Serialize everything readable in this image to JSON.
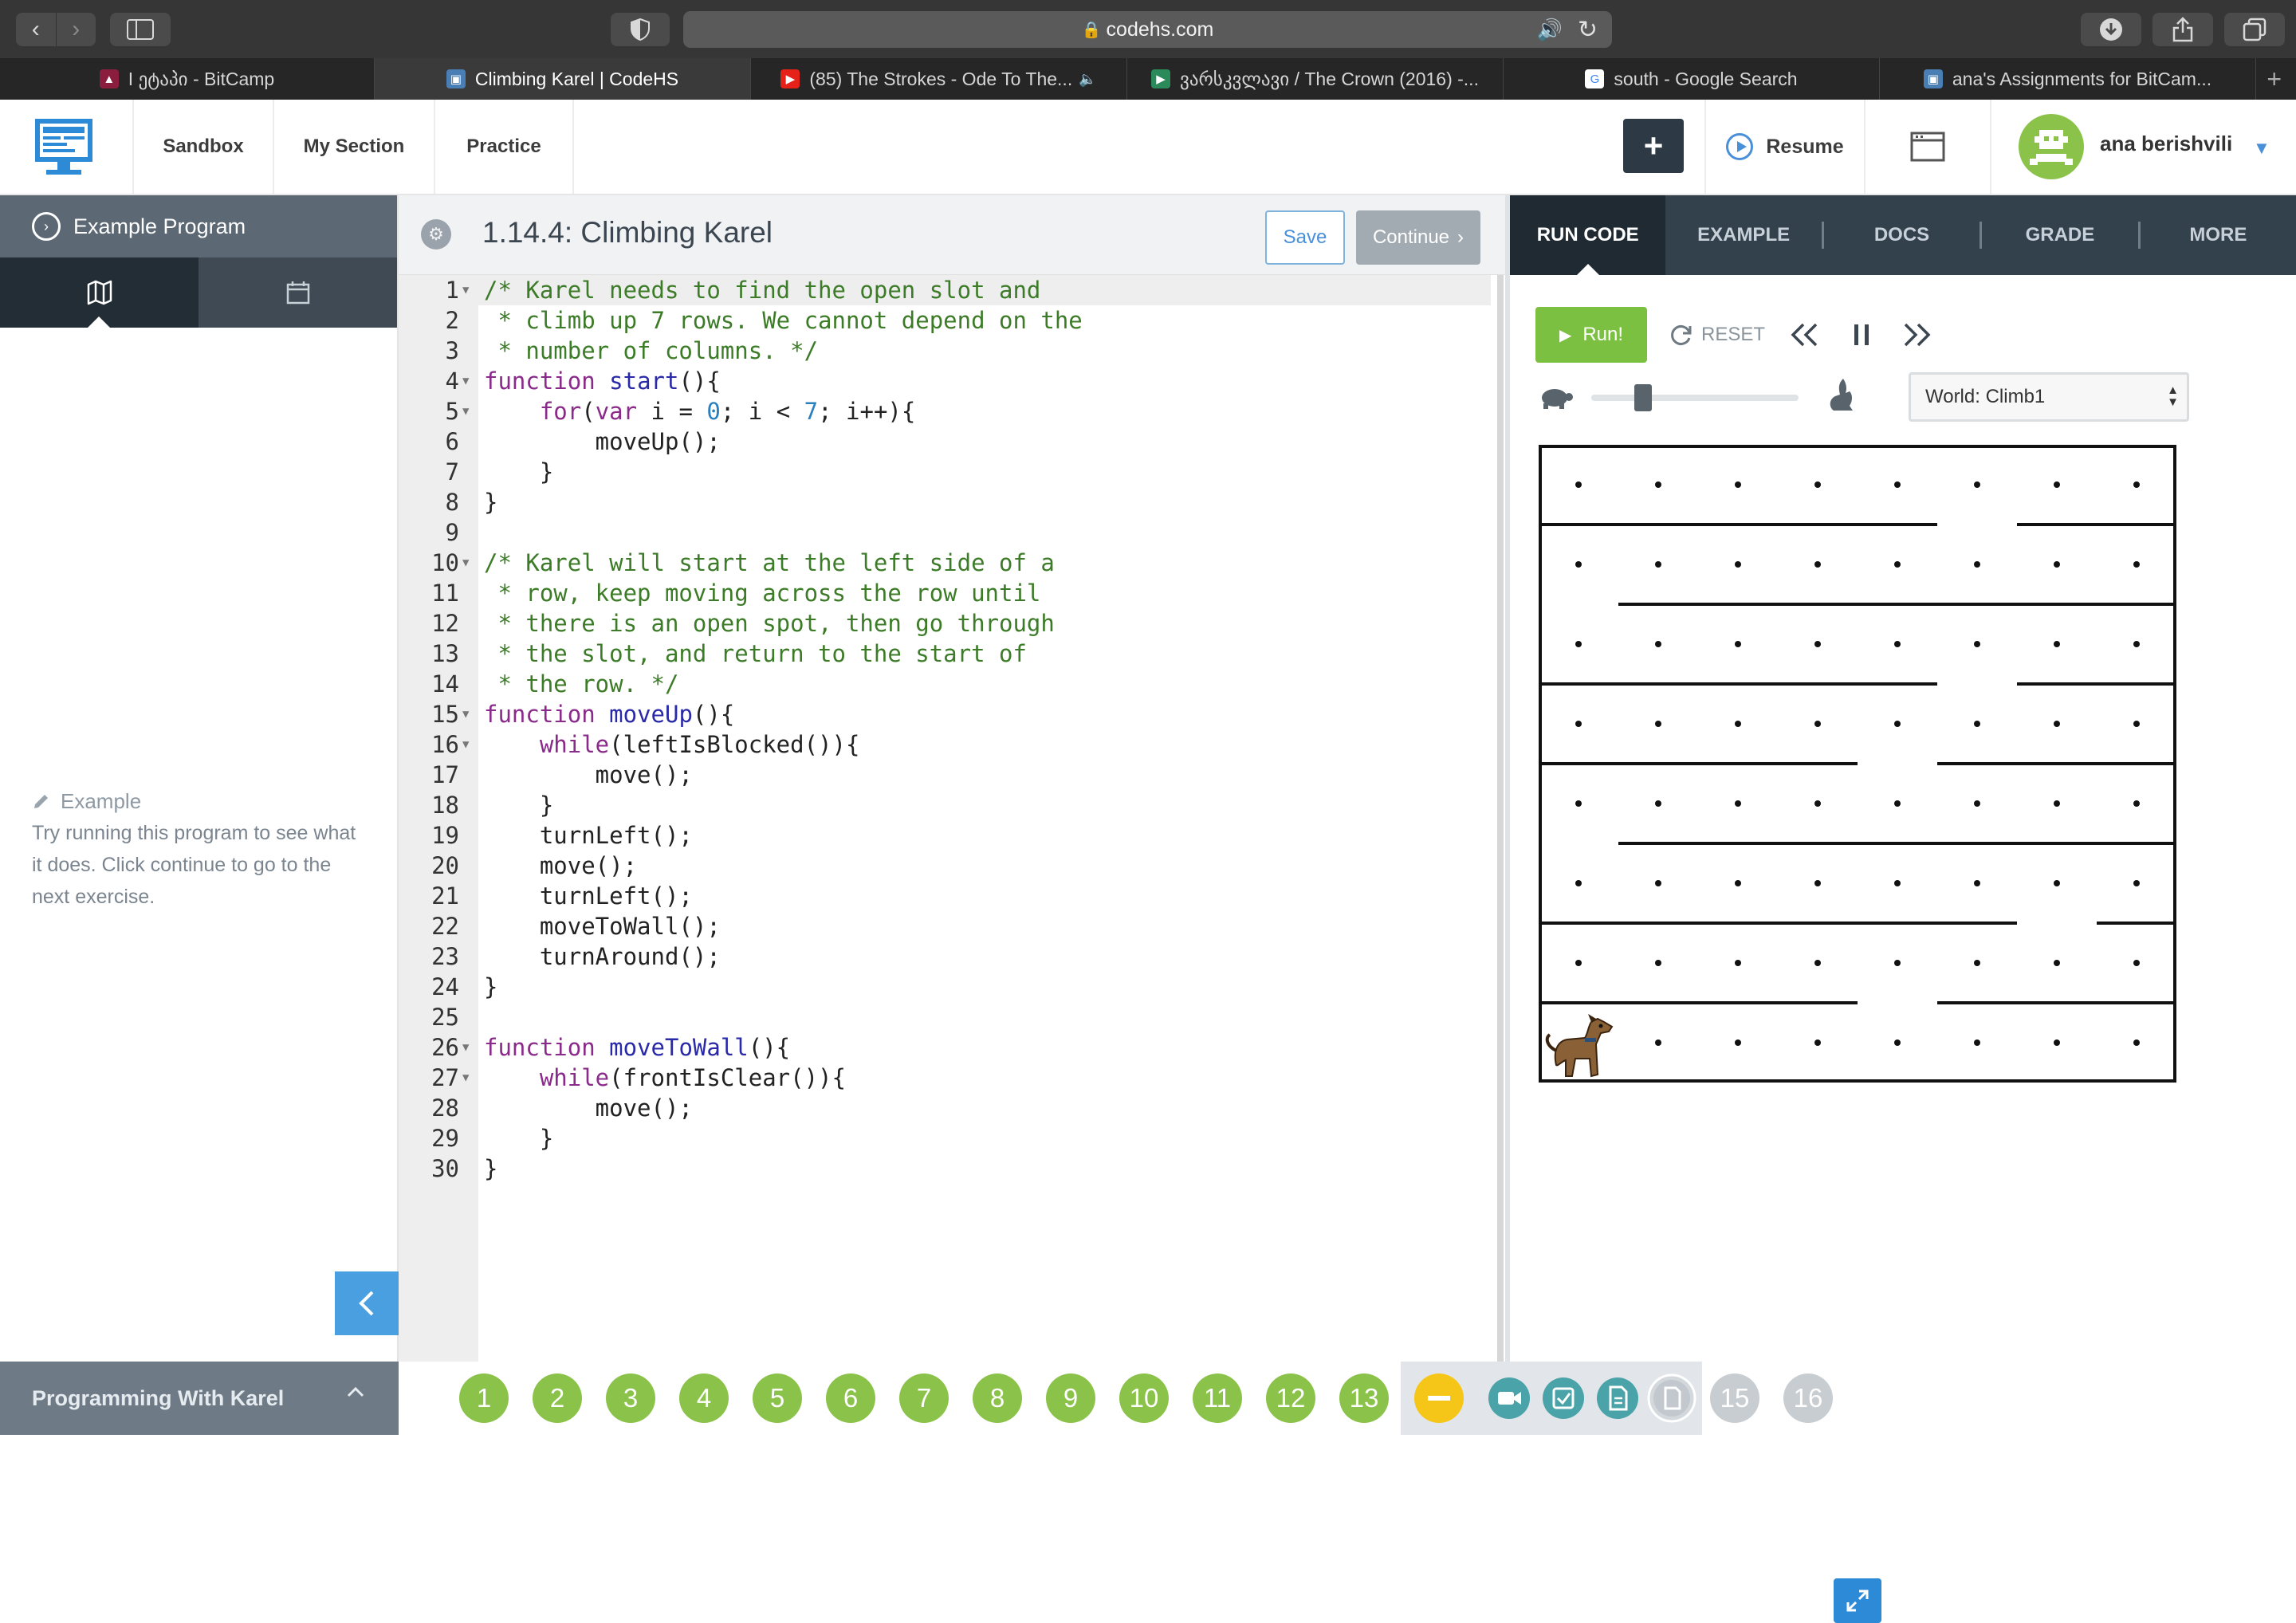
{
  "browser": {
    "url": "codehs.com",
    "tabs": [
      {
        "title": "I ეტაპი - BitCamp",
        "fav_color": "#8b1e3f",
        "fav_text": "▲"
      },
      {
        "title": "Climbing Karel | CodeHS",
        "fav_color": "#4a7fb5",
        "fav_text": "▣",
        "active": true
      },
      {
        "title": "(85) The Strokes - Ode To The...",
        "fav_color": "#e62117",
        "fav_text": "▶",
        "speaker": true
      },
      {
        "title": "ვარსკვლავი / The Crown (2016) -...",
        "fav_color": "#2a8a5a",
        "fav_text": "▶"
      },
      {
        "title": "south - Google Search",
        "fav_color": "#ffffff",
        "fav_text": "G"
      },
      {
        "title": "ana's Assignments for BitCam...",
        "fav_color": "#4a7fb5",
        "fav_text": "▣"
      }
    ]
  },
  "header": {
    "nav": [
      "Sandbox",
      "My Section",
      "Practice"
    ],
    "plus_label": "+",
    "resume_label": "Resume",
    "user_name": "ana berishvili"
  },
  "sidebar": {
    "section_title": "Example Program",
    "note_title": "Example",
    "note_text": "Try running this program to see what it does. Click continue to go to the next exercise.",
    "course_title": "Programming With Karel"
  },
  "editor": {
    "exercise_title": "1.14.4: Climbing Karel",
    "save_label": "Save",
    "continue_label": "Continue",
    "code_lines": [
      "/* Karel needs to find the open slot and",
      " * climb up 7 rows. We cannot depend on the",
      " * number of columns. */",
      "function start(){",
      "    for(var i = 0; i < 7; i++){",
      "        moveUp();",
      "    }",
      "}",
      "",
      "/* Karel will start at the left side of a",
      " * row, keep moving across the row until",
      " * there is an open spot, then go through",
      " * the slot, and return to the start of",
      " * the row. */",
      "function moveUp(){",
      "    while(leftIsBlocked()){",
      "        move();",
      "    }",
      "    turnLeft();",
      "    move();",
      "    turnLeft();",
      "    moveToWall();",
      "    turnAround();",
      "}",
      "",
      "function moveToWall(){",
      "    while(frontIsClear()){",
      "        move();",
      "    }",
      "}"
    ],
    "fold_lines": [
      1,
      4,
      5,
      10,
      15,
      16,
      26,
      27
    ]
  },
  "right_panel": {
    "tabs": [
      "RUN CODE",
      "EXAMPLE",
      "DOCS",
      "GRADE",
      "MORE"
    ],
    "active_tab": "RUN CODE",
    "run_label": "Run!",
    "reset_label": "RESET",
    "world_label": "World: Climb1",
    "speed_level": 0.25
  },
  "karel_world": {
    "cols": 8,
    "rows": 8,
    "karel_position": {
      "col": 1,
      "row": 1
    },
    "wall_gaps_by_row_from_top": [
      6,
      1,
      6,
      5,
      1,
      7,
      5
    ]
  },
  "progress": {
    "done_numbers": [
      "1",
      "2",
      "3",
      "4",
      "5",
      "6",
      "7",
      "8",
      "9",
      "10",
      "11",
      "12",
      "13"
    ],
    "current_items": [
      "minus-icon",
      "video-icon",
      "check-icon",
      "doc-icon",
      "doc-current-icon"
    ],
    "todo_numbers": [
      "15",
      "16"
    ]
  },
  "colors": {
    "green": "#8bc34a",
    "run_green": "#7cc041",
    "blue": "#4a90d9",
    "dark_tab": "#33414d",
    "current_yellow": "#f5c518"
  }
}
